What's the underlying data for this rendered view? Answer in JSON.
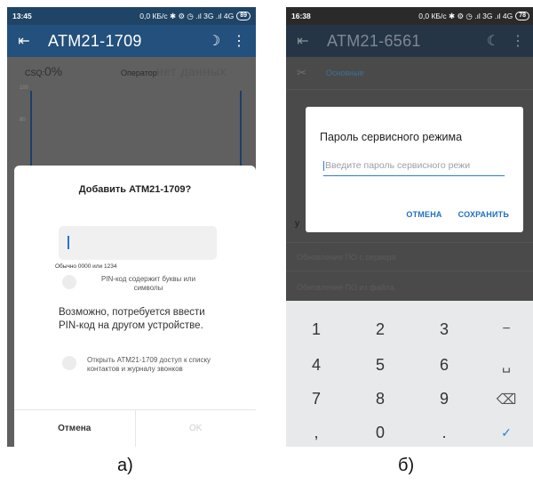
{
  "screen_a": {
    "status": {
      "time": "13:45",
      "right": "0,0 КБ/с ✱ ⚙ ◷ .ıl 3G .ıl 4G",
      "battery": "89"
    },
    "appbar": {
      "title": "ATM21-1709"
    },
    "info": {
      "csq_label": "CSQ:",
      "csq_value": "0%",
      "operator_label": "Оператор:",
      "operator_value": "нет данных"
    },
    "chart_axis": [
      "100",
      "80"
    ],
    "dialog": {
      "title": "Добавить ATM21-1709?",
      "pin_hint": "Обычно 0000 или 1234",
      "option_letters": "PIN-код содержит буквы или символы",
      "maybe_text": "Возможно, потребуется ввести PIN-код на другом устройстве.",
      "option_contacts": "Открыть ATM21-1709 доступ к списку контактов и журналу звонков",
      "cancel": "Отмена",
      "ok": "OK"
    }
  },
  "screen_b": {
    "status": {
      "time": "16:38",
      "right": "0,0 КБ/с ✱ ⚙ ◷ .ıl 3G .ıl 4G",
      "battery": "78"
    },
    "appbar": {
      "title": "ATM21-6561"
    },
    "list": {
      "section": "Основные",
      "item_update_server": "Обновление ПО с сервера",
      "item_update_file": "Обновление ПО из файла",
      "letter": "у"
    },
    "dialog": {
      "title": "Пароль сервисного режима",
      "placeholder": "Введите пароль сервисного режи",
      "cancel": "ОТМЕНА",
      "save": "СОХРАНИТЬ"
    },
    "keypad": {
      "keys": [
        "1",
        "2",
        "3",
        "−",
        "4",
        "5",
        "6",
        "␣",
        "7",
        "8",
        "9",
        "⌫",
        ",",
        "0",
        ".",
        "✓"
      ]
    }
  },
  "captions": {
    "a": "а)",
    "b": "б)"
  }
}
